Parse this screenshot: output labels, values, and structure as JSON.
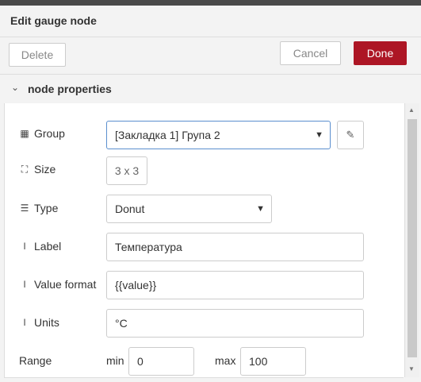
{
  "dialog": {
    "title": "Edit gauge node"
  },
  "toolbar": {
    "delete_label": "Delete",
    "cancel_label": "Cancel",
    "done_label": "Done"
  },
  "section": {
    "chevron": "⌄",
    "label": "node properties"
  },
  "form": {
    "group": {
      "label": "Group",
      "icon": "table-icon",
      "value": "[Закладка 1] Група 2",
      "edit_icon": "pencil-icon"
    },
    "size": {
      "label": "Size",
      "icon": "size-icon",
      "value": "3 x 3"
    },
    "type": {
      "label": "Type",
      "icon": "list-icon",
      "value": "Donut"
    },
    "label": {
      "label": "Label",
      "icon": "i-cursor-icon",
      "value": "Температура"
    },
    "value_format": {
      "label": "Value format",
      "icon": "i-cursor-icon",
      "value": "{{value}}"
    },
    "units": {
      "label": "Units",
      "icon": "i-cursor-icon",
      "value": "°C"
    },
    "range": {
      "label": "Range",
      "min_label": "min",
      "min_value": "0",
      "max_label": "max",
      "max_value": "100"
    }
  },
  "colors": {
    "done_button": "#ad1625",
    "focus_border": "#5b8fcf"
  }
}
